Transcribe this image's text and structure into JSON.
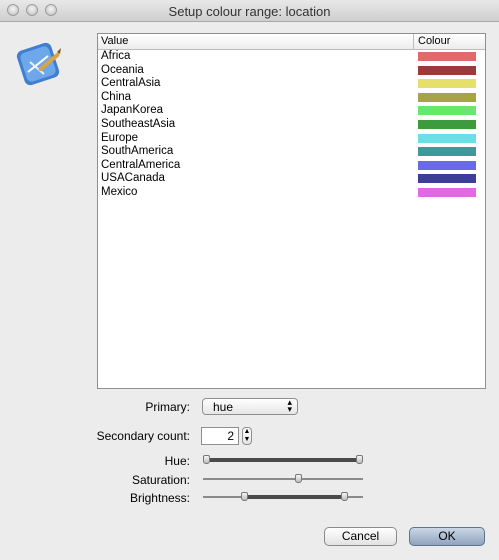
{
  "window": {
    "title": "Setup colour range: location"
  },
  "table": {
    "headers": {
      "value": "Value",
      "colour": "Colour"
    },
    "rows": [
      {
        "label": "Africa",
        "color": "#e06a6a"
      },
      {
        "label": "Oceania",
        "color": "#9a3a3a"
      },
      {
        "label": "CentralAsia",
        "color": "#e6e06a"
      },
      {
        "label": "China",
        "color": "#a8a445"
      },
      {
        "label": "JapanKorea",
        "color": "#6ae66a"
      },
      {
        "label": "SoutheastAsia",
        "color": "#3d9a3d"
      },
      {
        "label": "Europe",
        "color": "#6ae0e6"
      },
      {
        "label": "SouthAmerica",
        "color": "#3d9a9a"
      },
      {
        "label": "CentralAmerica",
        "color": "#6a6ae6"
      },
      {
        "label": "USACanada",
        "color": "#3d3d9a"
      },
      {
        "label": "Mexico",
        "color": "#e06ae0"
      }
    ]
  },
  "form": {
    "primary_label": "Primary:",
    "primary_value": "hue",
    "secondary_label": "Secondary count:",
    "secondary_value": "2",
    "hue_label": "Hue:",
    "saturation_label": "Saturation:",
    "brightness_label": "Brightness:",
    "hue_range": [
      0.0,
      1.0
    ],
    "saturation_value": 0.6,
    "brightness_range": [
      0.25,
      0.9
    ]
  },
  "buttons": {
    "cancel": "Cancel",
    "ok": "OK"
  },
  "icons": {
    "app": "colour-range-app-icon",
    "close": "close-light-icon",
    "minimize": "minimize-light-icon",
    "zoom": "zoom-light-icon",
    "select_arrows": "up-down-arrows-icon",
    "stepper": "stepper-arrows-icon"
  }
}
